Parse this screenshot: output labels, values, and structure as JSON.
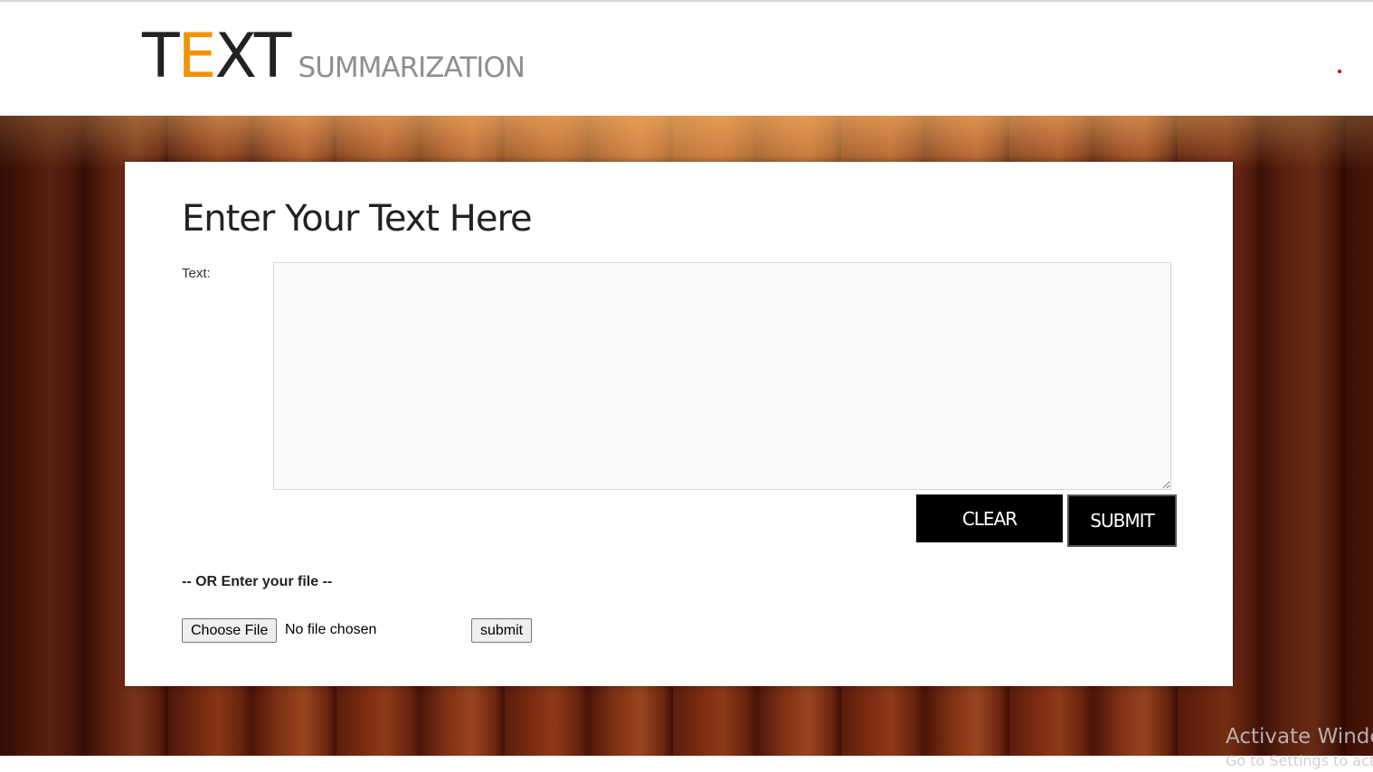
{
  "header": {
    "logo": {
      "letter_t": "T",
      "letter_e": "E",
      "letters_xt": "XT",
      "subtitle": "SUMMARIZATION"
    }
  },
  "form": {
    "title": "Enter Your Text Here",
    "text_label": "Text:",
    "textarea_value": "",
    "clear_label": "CLEAR",
    "submit_label": "SUBMIT",
    "or_label": "-- OR Enter your file --",
    "choose_file_label": "Choose File",
    "file_status": "No file chosen",
    "file_submit_label": "submit"
  },
  "watermark": {
    "line1": "Activate Windows",
    "line2": "Go to Settings to activate Windows."
  },
  "colors": {
    "logo_accent": "#f39200",
    "logo_sub": "#8f8f8f",
    "button_bg": "#000000",
    "wood": "#6b2410"
  }
}
